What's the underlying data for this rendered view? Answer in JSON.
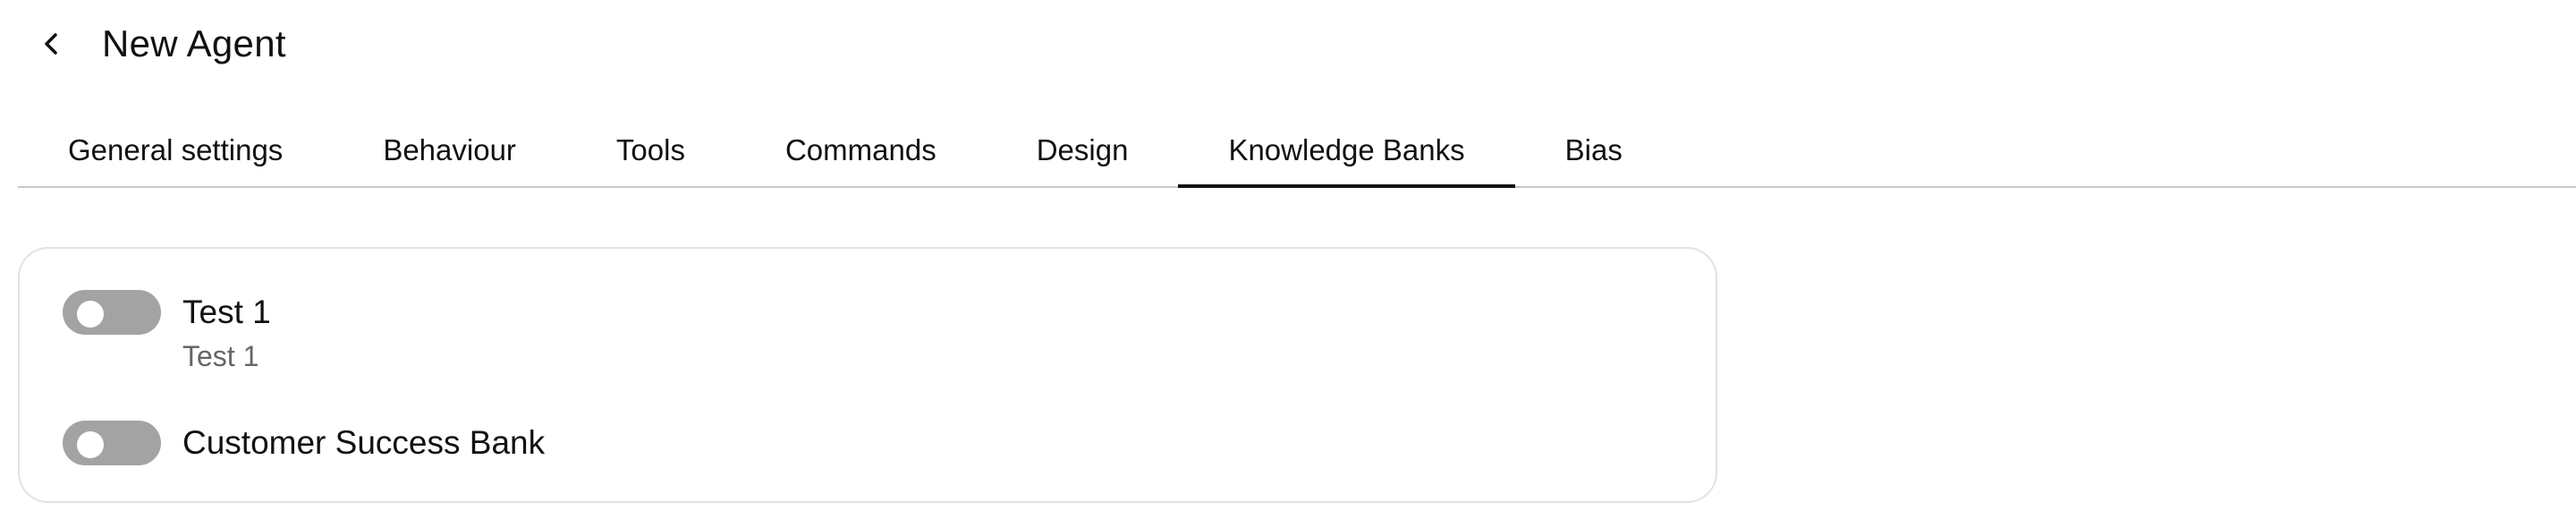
{
  "header": {
    "back_icon": "chevron-left-icon",
    "title": "New Agent"
  },
  "tabs": [
    {
      "label": "General settings",
      "active": false
    },
    {
      "label": "Behaviour",
      "active": false
    },
    {
      "label": "Tools",
      "active": false
    },
    {
      "label": "Commands",
      "active": false
    },
    {
      "label": "Design",
      "active": false
    },
    {
      "label": "Knowledge Banks",
      "active": true
    },
    {
      "label": "Bias",
      "active": false
    }
  ],
  "knowledge_banks": [
    {
      "name": "Test 1",
      "description": "Test 1",
      "enabled": false
    },
    {
      "name": "Customer Success Bank",
      "description": "",
      "enabled": false
    }
  ],
  "colors": {
    "toggle_off": "#a3a3a3",
    "active_tab_underline": "#111111",
    "divider": "#c8c8c8",
    "card_border": "#e2e2e2",
    "secondary_text": "#666666"
  }
}
